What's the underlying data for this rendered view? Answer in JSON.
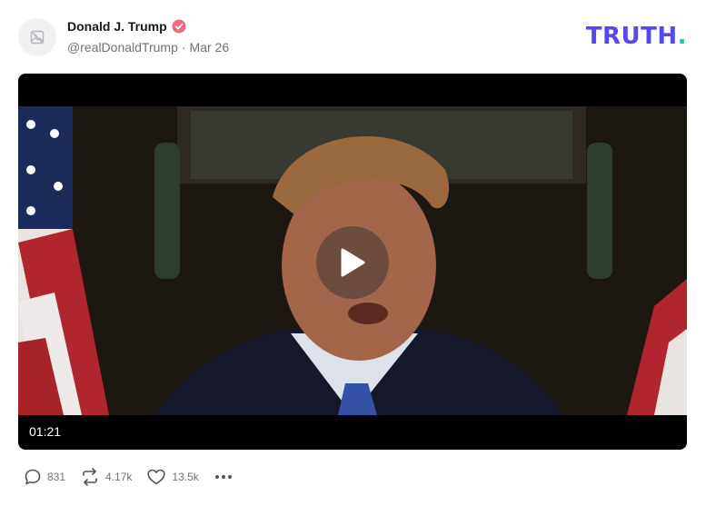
{
  "post": {
    "author_name": "Donald J. Trump",
    "handle": "@realDonaldTrump",
    "separator": "·",
    "date": "Mar 26"
  },
  "brand": {
    "logo_text": "TRUTH",
    "logo_dot": ".",
    "color": "#5448ee",
    "dot_color": "#0bd3a8"
  },
  "video": {
    "duration": "01:21"
  },
  "actions": {
    "replies": "831",
    "retruths": "4.17k",
    "likes": "13.5k"
  },
  "icons": [
    "image-placeholder-icon",
    "verified-icon",
    "play-icon",
    "reply-icon",
    "retruth-icon",
    "like-icon",
    "more-icon"
  ]
}
